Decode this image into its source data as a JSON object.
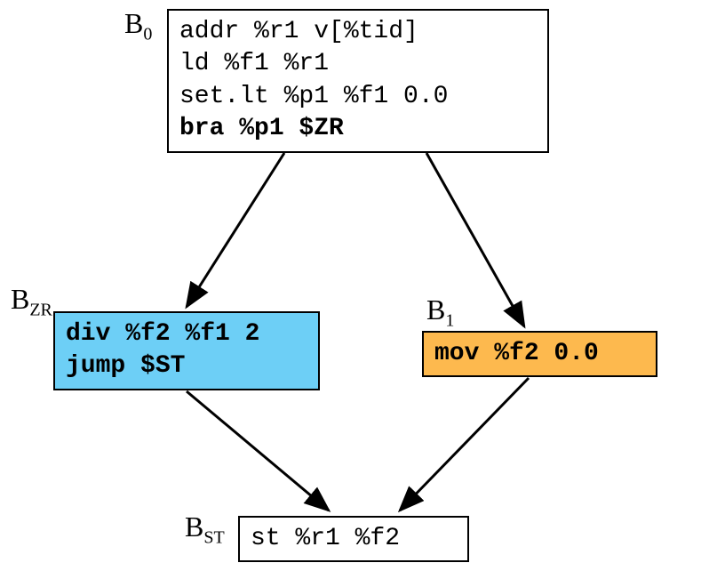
{
  "blocks": {
    "b0": {
      "label_main": "B",
      "label_sub": "0",
      "lines": [
        "addr %r1 v[%tid]",
        "ld %f1 %r1",
        "set.lt %p1 %f1 0.0"
      ],
      "bold_line": "bra %p1 $ZR"
    },
    "bzr": {
      "label_main": "B",
      "label_sub": "ZR",
      "bold_line1": "div %f2 %f1 2",
      "bold_line2": "jump $ST"
    },
    "b1": {
      "label_main": "B",
      "label_sub": "1",
      "bold_line": "mov %f2 0.0"
    },
    "bst": {
      "label_main": "B",
      "label_sub": "ST",
      "line": "st %r1 %f2"
    }
  }
}
